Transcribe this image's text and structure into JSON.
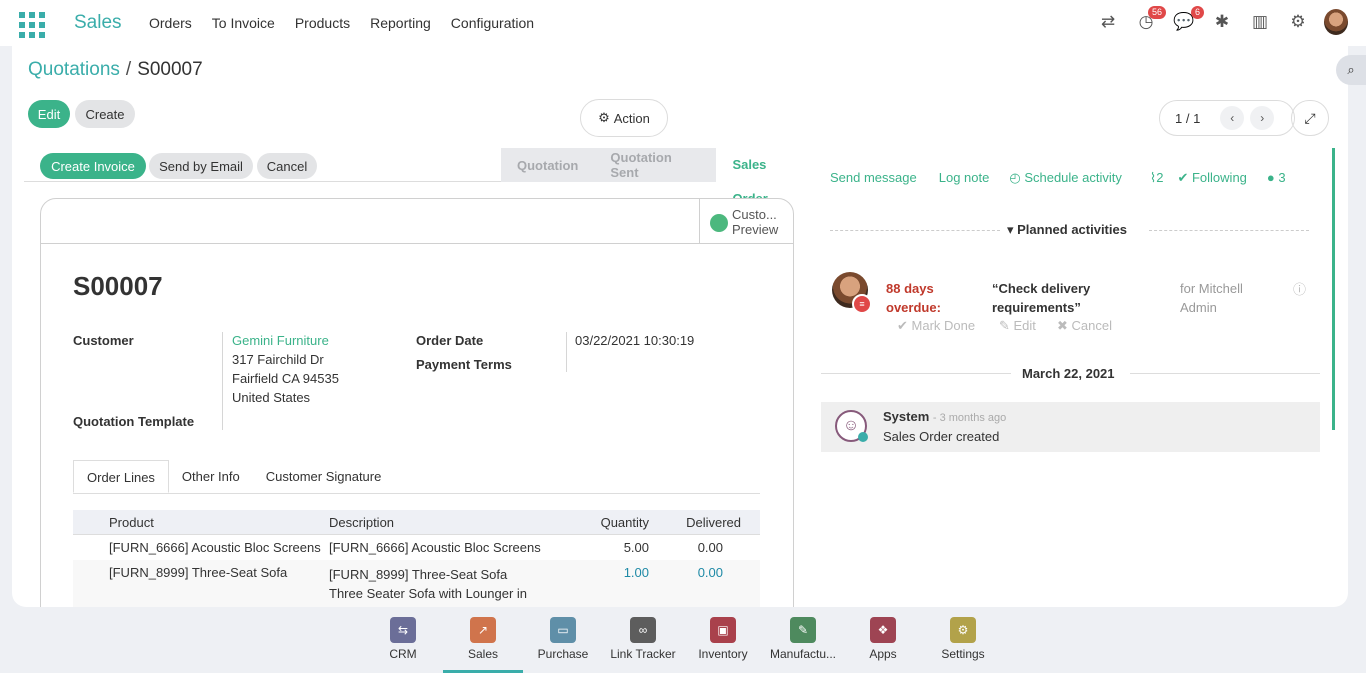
{
  "app": {
    "brand": "Sales"
  },
  "menu": [
    "Orders",
    "To Invoice",
    "Products",
    "Reporting",
    "Configuration"
  ],
  "systray": {
    "activity_count": "56",
    "message_count": "6"
  },
  "breadcrumb": {
    "parent": "Quotations",
    "separator": "/",
    "current": "S00007"
  },
  "toolbar": {
    "edit": "Edit",
    "create": "Create",
    "action": "Action",
    "pager": "1 / 1"
  },
  "statusbar": {
    "buttons": [
      "Create Invoice",
      "Send by Email",
      "Cancel"
    ],
    "states": [
      "Quotation",
      "Quotation Sent",
      "Sales Order"
    ],
    "active_state": "Sales Order"
  },
  "sheet": {
    "preview_label_1": "Custo...",
    "preview_label_2": "Preview",
    "title": "S00007",
    "customer_label": "Customer",
    "customer_name": "Gemini Furniture",
    "customer_address": [
      "317 Fairchild Dr",
      "Fairfield CA 94535",
      "United States"
    ],
    "order_date_label": "Order Date",
    "order_date": "03/22/2021 10:30:19",
    "payment_terms_label": "Payment Terms",
    "template_label": "Quotation Template",
    "tabs": [
      "Order Lines",
      "Other Info",
      "Customer Signature"
    ],
    "table_headers": [
      "Product",
      "Description",
      "Quantity",
      "Delivered"
    ],
    "rows": [
      {
        "product": "[FURN_6666] Acoustic Bloc Screens",
        "description": "[FURN_6666] Acoustic Bloc Screens",
        "description_2": "",
        "quantity": "5.00",
        "delivered": "0.00"
      },
      {
        "product": "[FURN_8999] Three-Seat Sofa",
        "description": "[FURN_8999] Three-Seat Sofa",
        "description_2": "Three Seater Sofa with Lounger in",
        "quantity": "1.00",
        "delivered": "0.00"
      }
    ]
  },
  "chatter": {
    "send_message": "Send message",
    "log_note": "Log note",
    "schedule_activity": "Schedule activity",
    "attachments": "2",
    "following": "Following",
    "followers": "3",
    "planned_activities": "Planned activities",
    "activity": {
      "overdue_1": "88 days",
      "overdue_2": "overdue:",
      "summary_1": "“Check delivery",
      "summary_2": "requirements”",
      "assignee_1": "for Mitchell",
      "assignee_2": "Admin",
      "mark_done": "Mark Done",
      "edit": "Edit",
      "cancel": "Cancel"
    },
    "date_separator": "March 22, 2021",
    "message": {
      "author": "System",
      "time": "- 3 months ago",
      "body": "Sales Order created"
    }
  },
  "taskbar": [
    "CRM",
    "Sales",
    "Purchase",
    "Link Tracker",
    "Inventory",
    "Manufactu...",
    "Apps",
    "Settings"
  ],
  "colors": {
    "brand": "#3aadaa",
    "primary": "#3bb38a",
    "overdue": "#c0392b"
  }
}
